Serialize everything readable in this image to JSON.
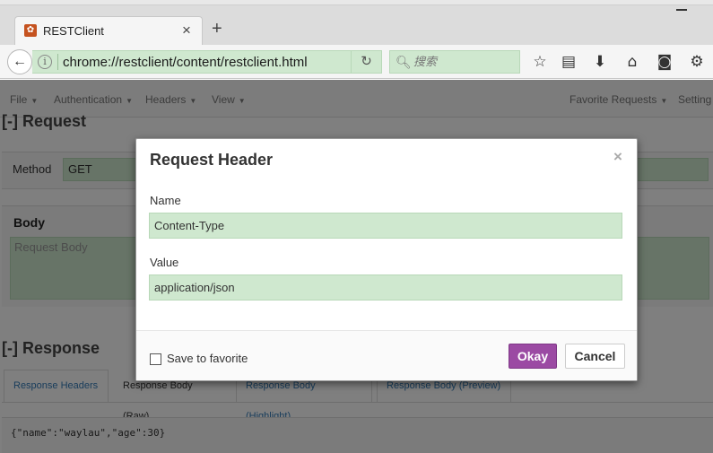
{
  "browser": {
    "tab_title": "RESTClient",
    "tab_close_glyph": "×",
    "new_tab_glyph": "+",
    "url": "chrome://restclient/content/restclient.html",
    "search_placeholder": "搜索",
    "toolbar_icons": [
      "star-icon",
      "reading-list-icon",
      "download-icon",
      "home-icon",
      "pocket-icon",
      "extension-icon"
    ]
  },
  "app": {
    "nav": {
      "file": "File",
      "authentication": "Authentication",
      "headers": "Headers",
      "view": "View",
      "favorite_requests": "Favorite Requests",
      "settings": "Setting"
    },
    "request_heading": "[-] Request",
    "method_label": "Method",
    "method_value": "GET",
    "body_label": "Body",
    "body_placeholder": "Request Body",
    "response_heading": "[-] Response",
    "response_tabs": [
      {
        "label": "Response Headers"
      },
      {
        "label": "Response Body (Raw)"
      },
      {
        "label": "Response Body (Highlight)"
      },
      {
        "label": "Response Body (Preview)"
      }
    ],
    "response_body": "{\"name\":\"waylau\",\"age\":30}"
  },
  "modal": {
    "title": "Request Header",
    "close_glyph": "×",
    "name_label": "Name",
    "name_value": "Content-Type",
    "value_label": "Value",
    "value_value": "application/json",
    "save_label": "Save to favorite",
    "okay_label": "Okay",
    "cancel_label": "Cancel"
  },
  "colors": {
    "accent_purple": "#9b4aa3",
    "input_green": "#cfe8cf"
  }
}
